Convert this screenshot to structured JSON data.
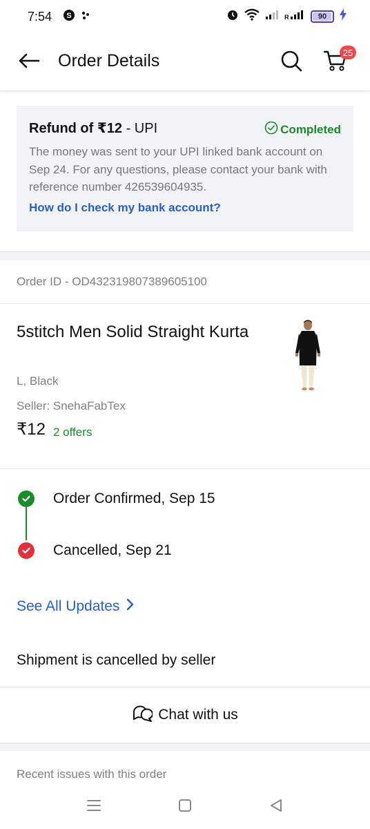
{
  "status_bar": {
    "time": "7:54",
    "battery_level": "90",
    "icons": [
      "app-s-icon",
      "dots-icon",
      "alarm-icon",
      "wifi-icon",
      "signal-icon",
      "roaming-signal-icon",
      "battery-icon",
      "charging-icon"
    ]
  },
  "app_bar": {
    "title": "Order Details",
    "cart_count": "25"
  },
  "refund": {
    "title_prefix": "Refund of ₹12",
    "title_suffix": " - UPI",
    "status": "Completed",
    "message": "The money was sent to your UPI linked bank account on Sep 24. For any questions, please contact your bank with reference number 426539604935.",
    "link": "How do I check my bank account?"
  },
  "order": {
    "id_text": "Order ID - OD432319807389605100"
  },
  "product": {
    "name": "5stitch Men Solid Straight Kurta",
    "variant": "L, Black",
    "seller": "Seller: SnehaFabTex",
    "price": "₹12",
    "offers": "2 offers"
  },
  "timeline": {
    "events": [
      {
        "label": "Order Confirmed, Sep 15",
        "status": "done"
      },
      {
        "label": "Cancelled, Sep 21",
        "status": "cancelled"
      }
    ],
    "see_all": "See All Updates"
  },
  "shipment_note": "Shipment is cancelled by seller",
  "chat": {
    "label": "Chat with us"
  },
  "recent_issues": "Recent issues with this order",
  "colors": {
    "accent_blue": "#2461c8",
    "success_green": "#1a8a2b",
    "error_red": "#e0323b",
    "badge_red": "#f0474c"
  }
}
